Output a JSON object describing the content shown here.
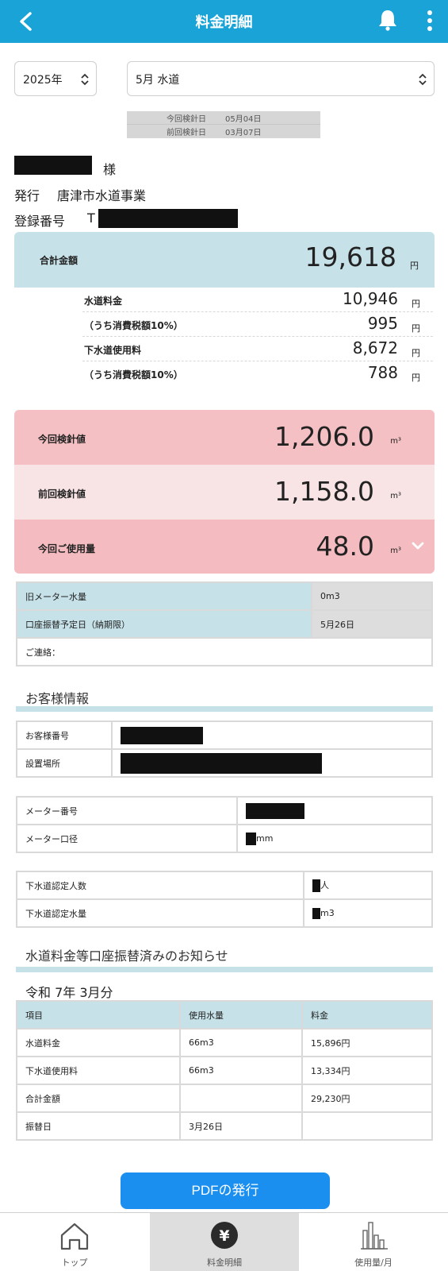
{
  "header": {
    "title": "料金明細"
  },
  "filters": {
    "year": "2025年",
    "month": "5月 水道"
  },
  "reading_dates": {
    "current_label": "今回検針日",
    "current_value": "05月04日",
    "previous_label": "前回検針日",
    "previous_value": "03月07日"
  },
  "customer": {
    "honorific": "様",
    "issuer_label": "発行",
    "issuer": "唐津市水道事業",
    "reg_label": "登録番号",
    "reg_prefix": "T"
  },
  "total": {
    "label": "合計金額",
    "amount": "19,618",
    "unit": "円"
  },
  "breakdown": [
    {
      "label": "水道料金",
      "value": "10,946",
      "unit": "円"
    },
    {
      "label": "（うち消費税額10%）",
      "value": "995",
      "unit": "円"
    },
    {
      "label": "下水道使用料",
      "value": "8,672",
      "unit": "円"
    },
    {
      "label": "（うち消費税額10%）",
      "value": "788",
      "unit": "円"
    }
  ],
  "meter": {
    "current_label": "今回検針値",
    "current_value": "1,206.0",
    "previous_label": "前回検針値",
    "previous_value": "1,158.0",
    "usage_label": "今回ご使用量",
    "usage_value": "48.0",
    "unit": "m³"
  },
  "info": [
    {
      "label": "旧メーター水量",
      "value": "0m3"
    },
    {
      "label": "口座振替予定日（納期限）",
      "value": "5月26日"
    },
    {
      "label": "ご連絡：",
      "value": ""
    }
  ],
  "customer_info": {
    "title": "お客様情報",
    "number_label": "お客様番号",
    "location_label": "設置場所",
    "meter_no_label": "メーター番号",
    "meter_caliber_label": "メーター口径",
    "meter_caliber_unit": "mm",
    "sewer_people_label": "下水道認定人数",
    "sewer_people_unit": "人",
    "sewer_volume_label": "下水道認定水量",
    "sewer_volume_unit": "m3"
  },
  "notice": {
    "title": "水道料金等口座振替済みのお知らせ",
    "period": "令和 7年 3月分",
    "headers": [
      "項目",
      "使用水量",
      "料金"
    ],
    "rows": [
      [
        "水道料金",
        "66m3",
        "15,896円"
      ],
      [
        "下水道使用料",
        "66m3",
        "13,334円"
      ],
      [
        "合計金額",
        "",
        "29,230円"
      ],
      [
        "振替日",
        "3月26日",
        ""
      ]
    ]
  },
  "pdf_button": "PDFの発行",
  "tabs": [
    {
      "label": "トップ",
      "icon": "home-icon"
    },
    {
      "label": "料金明細",
      "icon": "yen-icon",
      "active": true
    },
    {
      "label": "使用量/月",
      "icon": "bar-chart-icon"
    }
  ],
  "colors": {
    "header": "#1aa3d6",
    "accent_blue": "#c6e2e8",
    "meter_pink": "#f4c0c3",
    "pdf_button": "#1a8ff0"
  }
}
